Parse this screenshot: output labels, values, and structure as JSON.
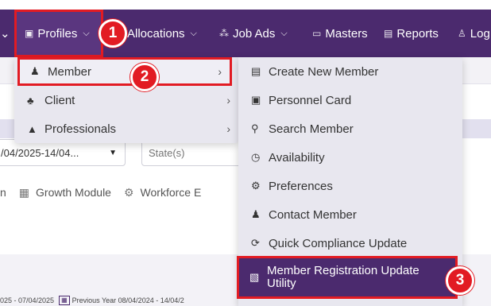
{
  "nav": {
    "partial_left_chevron": "⌄",
    "profiles": "Profiles",
    "allocations": "Allocations",
    "job_ads": "Job Ads",
    "masters": "Masters",
    "reports": "Reports",
    "logout_partial": "Log"
  },
  "filters": {
    "date_range": "/04/2025-14/04...",
    "state_placeholder": "State(s)"
  },
  "modules": {
    "partial": "n",
    "growth": "Growth Module",
    "workforce": "Workforce E"
  },
  "dates": {
    "current_partial": "025 - 07/04/2025",
    "previous": "Previous Year 08/04/2024 - 14/04/2"
  },
  "profiles_menu": {
    "member": "Member",
    "client": "Client",
    "professionals": "Professionals"
  },
  "member_menu": {
    "create": "Create New Member",
    "personnel_card": "Personnel Card",
    "search": "Search Member",
    "availability": "Availability",
    "preferences": "Preferences",
    "contact": "Contact Member",
    "quick_compliance": "Quick Compliance Update",
    "registration_utility": "Member Registration Update Utility"
  },
  "steps": {
    "one": "1",
    "two": "2",
    "three": "3"
  },
  "colors": {
    "nav_bg": "#4b2a6e",
    "highlight_red": "#e21b23",
    "menu_bg": "#e8e7ef"
  }
}
